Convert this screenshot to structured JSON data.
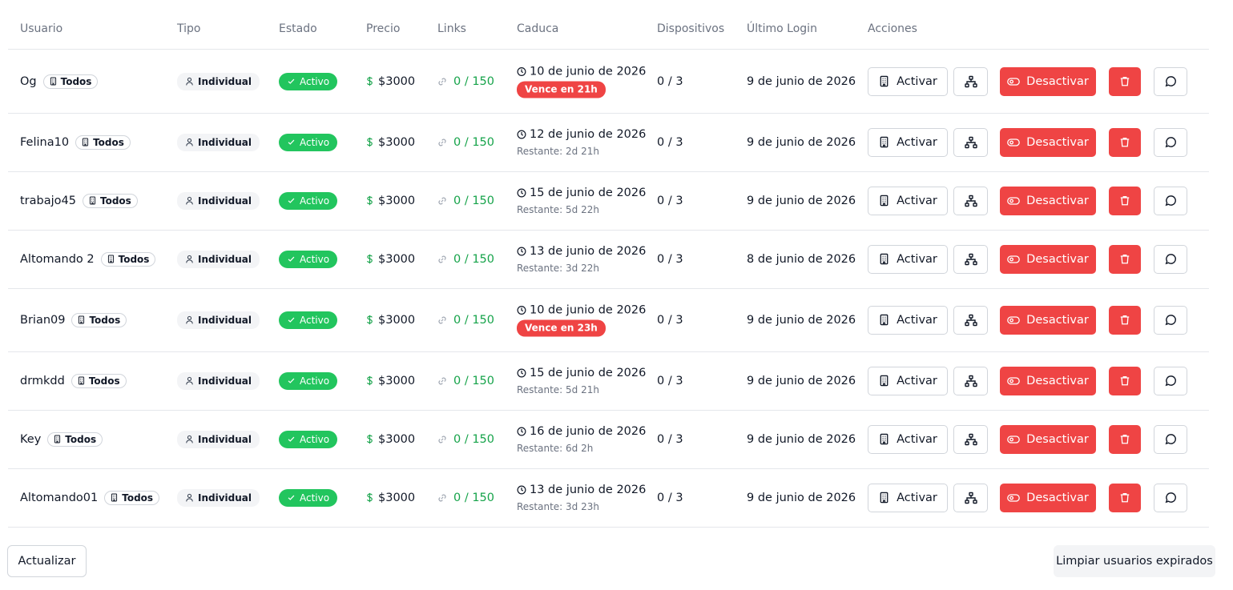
{
  "headers": [
    "Usuario",
    "Tipo",
    "Estado",
    "Precio",
    "Links",
    "Caduca",
    "Dispositivos",
    "Último Login",
    "Acciones"
  ],
  "rows": [
    {
      "user": "Og",
      "scope": "Todos",
      "type": "Individual",
      "status": "Activo",
      "price": "$3000",
      "links": "0 / 150",
      "expires": "10 de junio de 2026",
      "remaining": "Vence en 21h",
      "urgent": true,
      "devices": "0 / 3",
      "last_login": "9 de junio de 2026"
    },
    {
      "user": "Felina10",
      "scope": "Todos",
      "type": "Individual",
      "status": "Activo",
      "price": "$3000",
      "links": "0 / 150",
      "expires": "12 de junio de 2026",
      "remaining": "Restante: 2d 21h",
      "urgent": false,
      "devices": "0 / 3",
      "last_login": "9 de junio de 2026"
    },
    {
      "user": "trabajo45",
      "scope": "Todos",
      "type": "Individual",
      "status": "Activo",
      "price": "$3000",
      "links": "0 / 150",
      "expires": "15 de junio de 2026",
      "remaining": "Restante: 5d 22h",
      "urgent": false,
      "devices": "0 / 3",
      "last_login": "9 de junio de 2026"
    },
    {
      "user": "Altomando 2",
      "scope": "Todos",
      "type": "Individual",
      "status": "Activo",
      "price": "$3000",
      "links": "0 / 150",
      "expires": "13 de junio de 2026",
      "remaining": "Restante: 3d 22h",
      "urgent": false,
      "devices": "0 / 3",
      "last_login": "8 de junio de 2026"
    },
    {
      "user": "Brian09",
      "scope": "Todos",
      "type": "Individual",
      "status": "Activo",
      "price": "$3000",
      "links": "0 / 150",
      "expires": "10 de junio de 2026",
      "remaining": "Vence en 23h",
      "urgent": true,
      "devices": "0 / 3",
      "last_login": "9 de junio de 2026"
    },
    {
      "user": "drmkdd",
      "scope": "Todos",
      "type": "Individual",
      "status": "Activo",
      "price": "$3000",
      "links": "0 / 150",
      "expires": "15 de junio de 2026",
      "remaining": "Restante: 5d 21h",
      "urgent": false,
      "devices": "0 / 3",
      "last_login": "9 de junio de 2026"
    },
    {
      "user": "Key",
      "scope": "Todos",
      "type": "Individual",
      "status": "Activo",
      "price": "$3000",
      "links": "0 / 150",
      "expires": "16 de junio de 2026",
      "remaining": "Restante: 6d 2h",
      "urgent": false,
      "devices": "0 / 3",
      "last_login": "9 de junio de 2026"
    },
    {
      "user": "Altomando01",
      "scope": "Todos",
      "type": "Individual",
      "status": "Activo",
      "price": "$3000",
      "links": "0 / 150",
      "expires": "13 de junio de 2026",
      "remaining": "Restante: 3d 23h",
      "urgent": false,
      "devices": "0 / 3",
      "last_login": "9 de junio de 2026"
    }
  ],
  "actions": {
    "activate": "Activar",
    "deactivate": "Desactivar"
  },
  "icons": {
    "scope": "building-icon",
    "type": "user-icon",
    "status": "check-icon",
    "price": "dollar-icon",
    "links": "link-icon",
    "expires": "clock-icon",
    "activate": "building-icon",
    "tree": "sitemap-icon",
    "deactivate": "toggle-icon",
    "delete": "trash-icon",
    "chat": "chat-icon"
  },
  "colors": {
    "accent_green": "#22c55e",
    "link_green": "#16a34a",
    "danger": "#ef4444",
    "border": "#e5e7eb",
    "muted": "#6b7280"
  },
  "footer": {
    "refresh": "Actualizar",
    "clear_expired": "Limpiar usuarios expirados"
  }
}
